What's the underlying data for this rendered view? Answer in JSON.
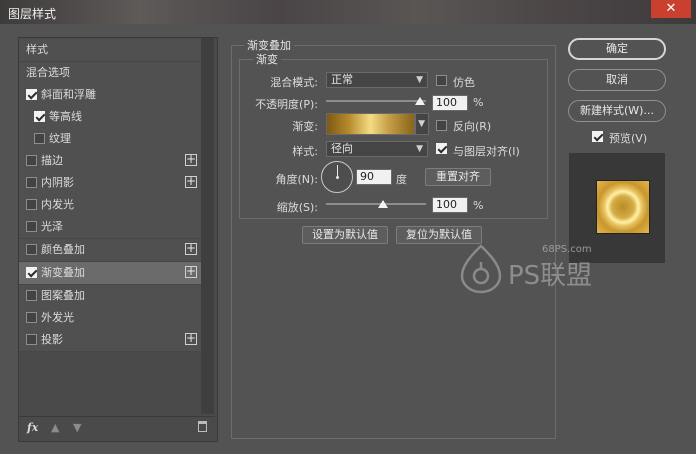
{
  "window": {
    "title": "图层样式",
    "close_glyph": "✕"
  },
  "style_list": {
    "header": "样式",
    "items": [
      {
        "label": "混合选项",
        "checkbox": false,
        "checked": false,
        "plus": false
      },
      {
        "label": "斜面和浮雕",
        "checkbox": true,
        "checked": true,
        "plus": false
      },
      {
        "label": "等高线",
        "checkbox": true,
        "checked": true,
        "plus": false,
        "indent": true
      },
      {
        "label": "纹理",
        "checkbox": true,
        "checked": false,
        "plus": false,
        "indent": true
      },
      {
        "label": "描边",
        "checkbox": true,
        "checked": false,
        "plus": true
      },
      {
        "label": "内阴影",
        "checkbox": true,
        "checked": false,
        "plus": true
      },
      {
        "label": "内发光",
        "checkbox": true,
        "checked": false,
        "plus": false
      },
      {
        "label": "光泽",
        "checkbox": true,
        "checked": false,
        "plus": false
      },
      {
        "label": "颜色叠加",
        "checkbox": true,
        "checked": false,
        "plus": true
      },
      {
        "label": "渐变叠加",
        "checkbox": true,
        "checked": true,
        "plus": true,
        "selected": true
      },
      {
        "label": "图案叠加",
        "checkbox": true,
        "checked": false,
        "plus": false
      },
      {
        "label": "外发光",
        "checkbox": true,
        "checked": false,
        "plus": false
      },
      {
        "label": "投影",
        "checkbox": true,
        "checked": false,
        "plus": true
      }
    ],
    "footer": {
      "fx_label": "fx",
      "up_icon": "arrow-up-icon",
      "down_icon": "arrow-down-icon",
      "trash_icon": "trash-icon"
    }
  },
  "gradient_overlay": {
    "group_title": "渐变叠加",
    "sub_group_title": "渐变",
    "blend_mode": {
      "label": "混合模式:",
      "value": "正常"
    },
    "dither": {
      "label": "仿色",
      "checked": false
    },
    "opacity": {
      "label": "不透明度(P):",
      "value": "100",
      "unit": "%",
      "level": 1.0
    },
    "gradient": {
      "label": "渐变:",
      "colors": [
        "#7d5a14",
        "#b58a2c",
        "#f4dc84",
        "#c6a04a",
        "#8a6418"
      ]
    },
    "reverse": {
      "label": "反向(R)",
      "checked": false
    },
    "style": {
      "label": "样式:",
      "value": "径向"
    },
    "align_with_layer": {
      "label": "与图层对齐(I)",
      "checked": true
    },
    "angle": {
      "label": "角度(N):",
      "value": "90",
      "unit": "度"
    },
    "reset_alignment_label": "重置对齐",
    "scale": {
      "label": "缩放(S):",
      "value": "100",
      "unit": "%",
      "level": 0.5
    },
    "make_default_label": "设置为默认值",
    "reset_default_label": "复位为默认值"
  },
  "right_panel": {
    "ok_label": "确定",
    "cancel_label": "取消",
    "new_style_label": "新建样式(W)...",
    "preview": {
      "label": "预览(V)",
      "checked": true
    }
  },
  "watermark": {
    "site": "68PS.com",
    "text": "PS联盟"
  }
}
